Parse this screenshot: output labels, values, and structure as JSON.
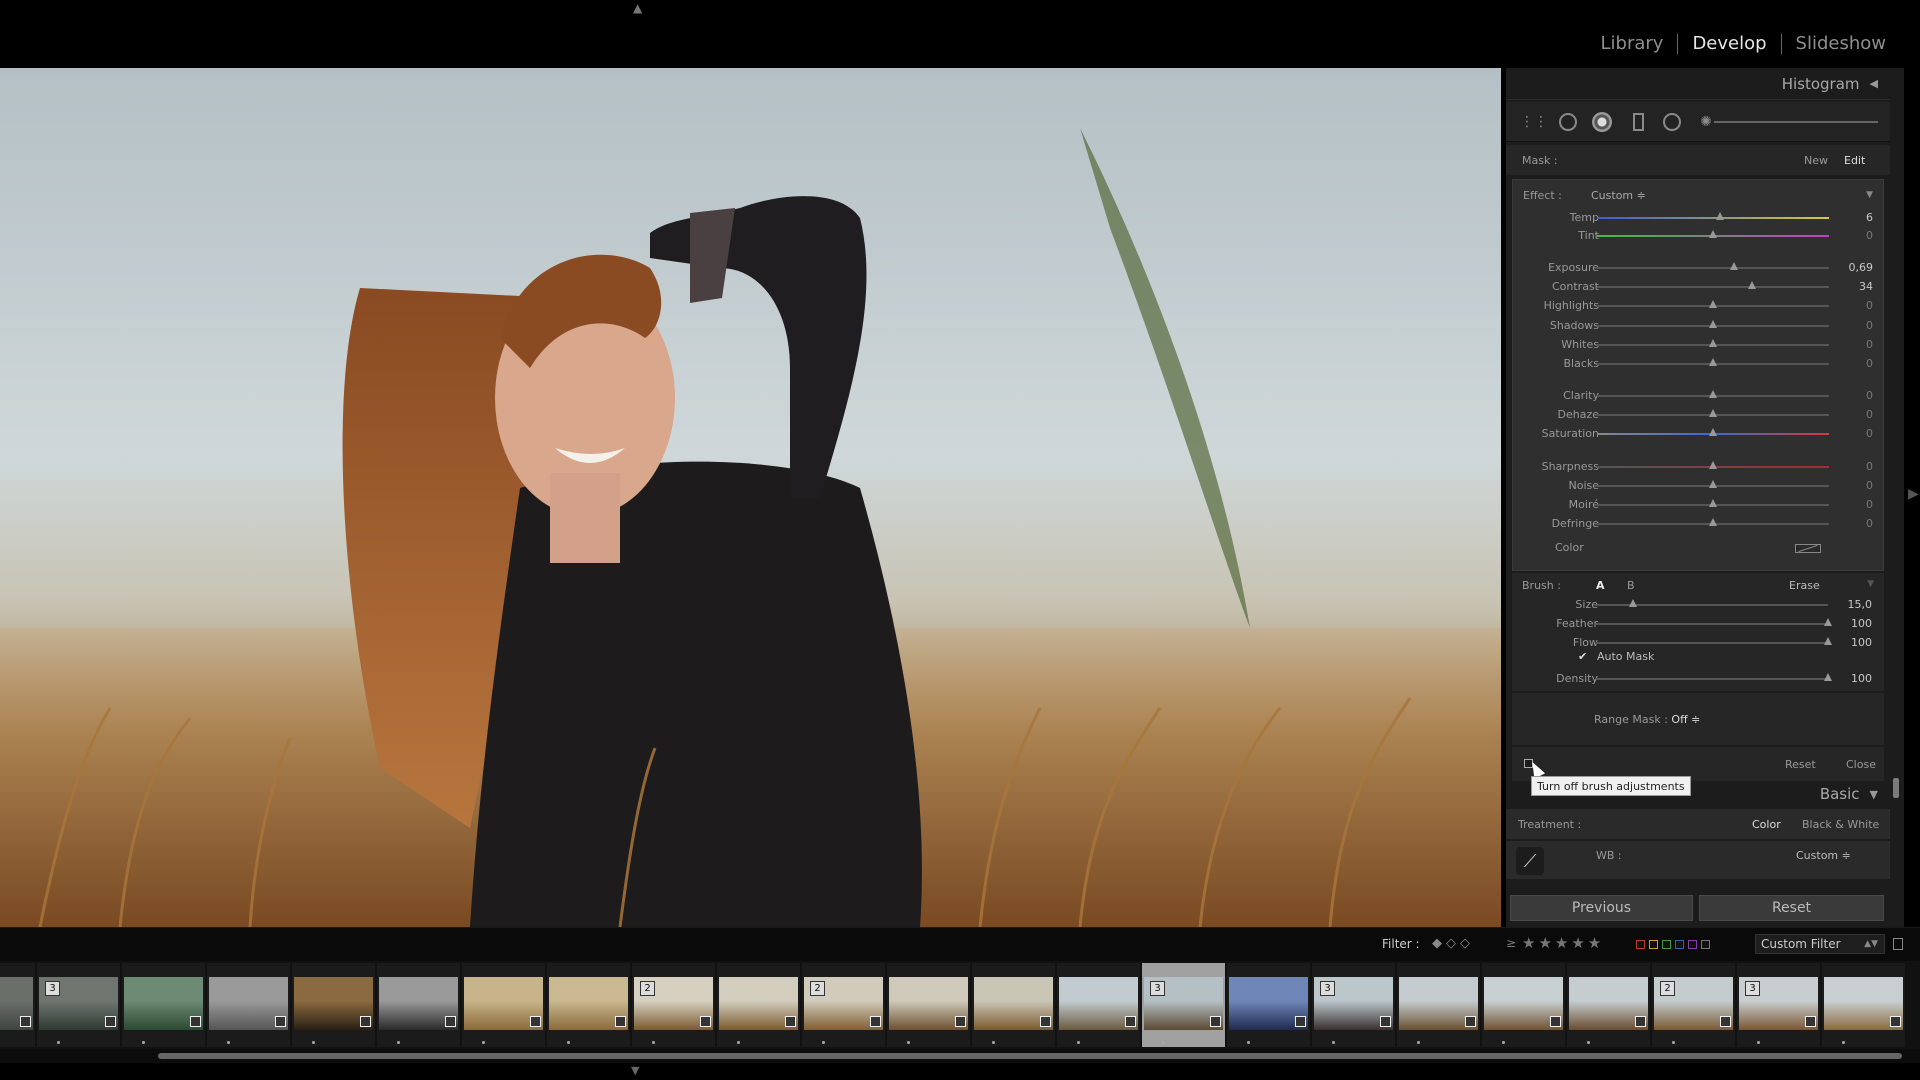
{
  "modules": [
    "Library",
    "Develop",
    "Slideshow"
  ],
  "active_module": "Develop",
  "panel": {
    "histogram_title": "Histogram",
    "mask": {
      "label": "Mask :",
      "new": "New",
      "edit": "Edit"
    },
    "effect": {
      "label": "Effect :",
      "value": "Custom ≑"
    },
    "sliders": [
      {
        "label": "Temp",
        "value": "6",
        "position": 0.53,
        "track": "temp"
      },
      {
        "label": "Tint",
        "value": "0",
        "position": 0.5,
        "track": "tint"
      },
      {
        "label": "Exposure",
        "value": "0,69",
        "position": 0.59,
        "track": "gray"
      },
      {
        "label": "Contrast",
        "value": "34",
        "position": 0.67,
        "track": "gray"
      },
      {
        "label": "Highlights",
        "value": "0",
        "position": 0.5,
        "track": "gray"
      },
      {
        "label": "Shadows",
        "value": "0",
        "position": 0.5,
        "track": "gray"
      },
      {
        "label": "Whites",
        "value": "0",
        "position": 0.5,
        "track": "gray"
      },
      {
        "label": "Blacks",
        "value": "0",
        "position": 0.5,
        "track": "gray"
      },
      {
        "label": "Clarity",
        "value": "0",
        "position": 0.5,
        "track": "gray"
      },
      {
        "label": "Dehaze",
        "value": "0",
        "position": 0.5,
        "track": "gray"
      },
      {
        "label": "Saturation",
        "value": "0",
        "position": 0.5,
        "track": "sat"
      },
      {
        "label": "Sharpness",
        "value": "0",
        "position": 0.5,
        "track": "sharp"
      },
      {
        "label": "Noise",
        "value": "0",
        "position": 0.5,
        "track": "gray"
      },
      {
        "label": "Moiré",
        "value": "0",
        "position": 0.5,
        "track": "gray"
      },
      {
        "label": "Defringe",
        "value": "0",
        "position": 0.5,
        "track": "gray"
      }
    ],
    "color_label": "Color",
    "brush": {
      "label": "Brush :",
      "a": "A",
      "b": "B",
      "erase": "Erase",
      "sliders": [
        {
          "label": "Size",
          "value": "15,0",
          "position": 0.16
        },
        {
          "label": "Feather",
          "value": "100",
          "position": 1.0
        },
        {
          "label": "Flow",
          "value": "100",
          "position": 1.0
        },
        {
          "label": "Density",
          "value": "100",
          "position": 1.0
        }
      ],
      "auto_mask": "Auto Mask",
      "auto_mask_checked": true
    },
    "range_mask": {
      "label": "Range Mask :",
      "value": "Off ≑"
    },
    "reset": "Reset",
    "close": "Close",
    "tooltip": "Turn off brush adjustments",
    "basic_title": "Basic",
    "treatment": {
      "label": "Treatment :",
      "color": "Color",
      "bw": "Black & White"
    },
    "wb": {
      "label": "WB :",
      "value": "Custom ≑"
    },
    "previous_button": "Previous",
    "reset_button": "Reset"
  },
  "filter": {
    "label": "Filter :",
    "rating_op": "≥",
    "stars": "★★★★★",
    "preset": "Custom Filter",
    "chip_colors": [
      "#c0392b",
      "#c9a227",
      "#3a9a3a",
      "#3a5fb0",
      "#8a3ab0",
      "#777777"
    ]
  },
  "filmstrip": [
    {
      "tone": [
        "#6a6f6a",
        "#3e4440"
      ],
      "badge": ""
    },
    {
      "tone": [
        "#6f7670",
        "#2f3a33"
      ],
      "badge": "3"
    },
    {
      "tone": [
        "#6c8a74",
        "#2c4a30"
      ],
      "badge": ""
    },
    {
      "tone": [
        "#9a9a9a",
        "#555555"
      ],
      "badge": ""
    },
    {
      "tone": [
        "#8a6a40",
        "#2a1f15"
      ],
      "badge": ""
    },
    {
      "tone": [
        "#9a9a9a",
        "#2a2a2a"
      ],
      "badge": ""
    },
    {
      "tone": [
        "#c7b48a",
        "#8a6a3a"
      ],
      "badge": ""
    },
    {
      "tone": [
        "#c9b890",
        "#8a6a3a"
      ],
      "badge": ""
    },
    {
      "tone": [
        "#d6d0c0",
        "#7a5a30"
      ],
      "badge": "2"
    },
    {
      "tone": [
        "#d2cdbd",
        "#7a5a30"
      ],
      "badge": ""
    },
    {
      "tone": [
        "#d0cbbb",
        "#805e32"
      ],
      "badge": "2"
    },
    {
      "tone": [
        "#cfcabb",
        "#6d5030"
      ],
      "badge": ""
    },
    {
      "tone": [
        "#cac6b6",
        "#7a5a30"
      ],
      "badge": ""
    },
    {
      "tone": [
        "#c2ccd0",
        "#6a5a40"
      ],
      "badge": ""
    },
    {
      "tone": [
        "#b5c0c4",
        "#5a4a32"
      ],
      "badge": "3",
      "selected": true
    },
    {
      "tone": [
        "#6f86b8",
        "#1f2a50"
      ],
      "badge": ""
    },
    {
      "tone": [
        "#bcc7cb",
        "#3a3030"
      ],
      "badge": "3"
    },
    {
      "tone": [
        "#c4cccf",
        "#6a5030"
      ],
      "badge": ""
    },
    {
      "tone": [
        "#c8cfd1",
        "#705232"
      ],
      "badge": ""
    },
    {
      "tone": [
        "#c5cdcf",
        "#6a4c30"
      ],
      "badge": ""
    },
    {
      "tone": [
        "#c4ccce",
        "#7a5a34"
      ],
      "badge": "2"
    },
    {
      "tone": [
        "#c8cecf",
        "#7a5634"
      ],
      "badge": "3"
    },
    {
      "tone": [
        "#c9cfd0",
        "#8a6a40"
      ],
      "badge": ""
    }
  ]
}
